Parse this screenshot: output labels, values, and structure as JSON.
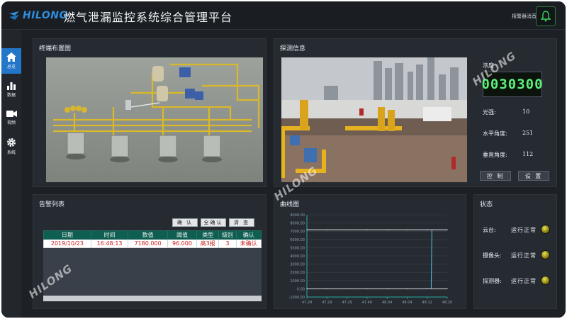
{
  "header": {
    "logo_text": "HILONG",
    "title": "燃气泄漏监控系统综合管理平台",
    "alarm_label": "报警器消音"
  },
  "sidebar": {
    "items": [
      {
        "label": "总览",
        "icon": "home-icon",
        "active": true
      },
      {
        "label": "数据",
        "icon": "bar-chart-icon",
        "active": false
      },
      {
        "label": "视频",
        "icon": "video-camera-icon",
        "active": false
      },
      {
        "label": "系统",
        "icon": "gear-icon",
        "active": false
      }
    ]
  },
  "layout_panel": {
    "title": "终端布置图"
  },
  "detect_panel": {
    "title": "探测信息",
    "concentration_label": "浓度",
    "concentration_value": "0030300",
    "light_label": "光强:",
    "light_value": "10",
    "h_angle_label": "水平角度:",
    "h_angle_value": "251",
    "v_angle_label": "垂直角度:",
    "v_angle_value": "112",
    "control_button": "控 制",
    "settings_button": "设 置"
  },
  "alarm_panel": {
    "title": "告警列表",
    "confirm_button": "确 认",
    "confirm_all_button": "全确认",
    "clear_button": "清 查",
    "columns": [
      "日期",
      "时间",
      "数值",
      "阈值",
      "类型",
      "级别",
      "确认"
    ],
    "rows": [
      [
        "2019/10/23",
        "16:48:13",
        "7180.000",
        "96.000",
        "高3报",
        "3",
        "未确认"
      ]
    ]
  },
  "curve_panel": {
    "title": "曲线图",
    "y_ticks": [
      "9000.00",
      "8000.00",
      "7000.00",
      "6000.00",
      "5000.00",
      "4000.00",
      "3000.00",
      "2000.00",
      "1000.00",
      "0.00",
      "-1000.00"
    ],
    "x_ticks": [
      "47.29",
      "47.29",
      "47.29",
      "47.46",
      "48.04",
      "48.04",
      "48.12",
      "48.20"
    ]
  },
  "chart_data": {
    "type": "line",
    "title": "曲线图",
    "xlabel": "",
    "ylabel": "",
    "ylim": [
      -1000,
      9000
    ],
    "x": [
      "47.29",
      "47.29",
      "47.29",
      "47.46",
      "48.04",
      "48.04",
      "48.12",
      "48.20"
    ],
    "series": [
      {
        "values": [
          0,
          0,
          0,
          0,
          0,
          0,
          0,
          0
        ]
      },
      {
        "values": [
          7180,
          7180,
          7180,
          7180,
          7180,
          7180,
          7180,
          7180
        ]
      }
    ],
    "spike": {
      "x_index": 6.2,
      "from": 0,
      "to": 7180
    },
    "grid": true,
    "colors": {
      "line": "#f4f6f8",
      "spike": "#4fc3e8",
      "axis": "#27a89a"
    }
  },
  "status_panel": {
    "title": "状态",
    "items": [
      {
        "label": "云台:",
        "value": "运行正常"
      },
      {
        "label": "摄像头:",
        "value": "运行正常"
      },
      {
        "label": "探测器:",
        "value": "运行正常"
      }
    ]
  },
  "watermark": "HILONG",
  "colors": {
    "accent": "#2277c9",
    "panel": "#262b31",
    "header_table": "#0f5e52",
    "alarm_text": "#c8201e"
  }
}
